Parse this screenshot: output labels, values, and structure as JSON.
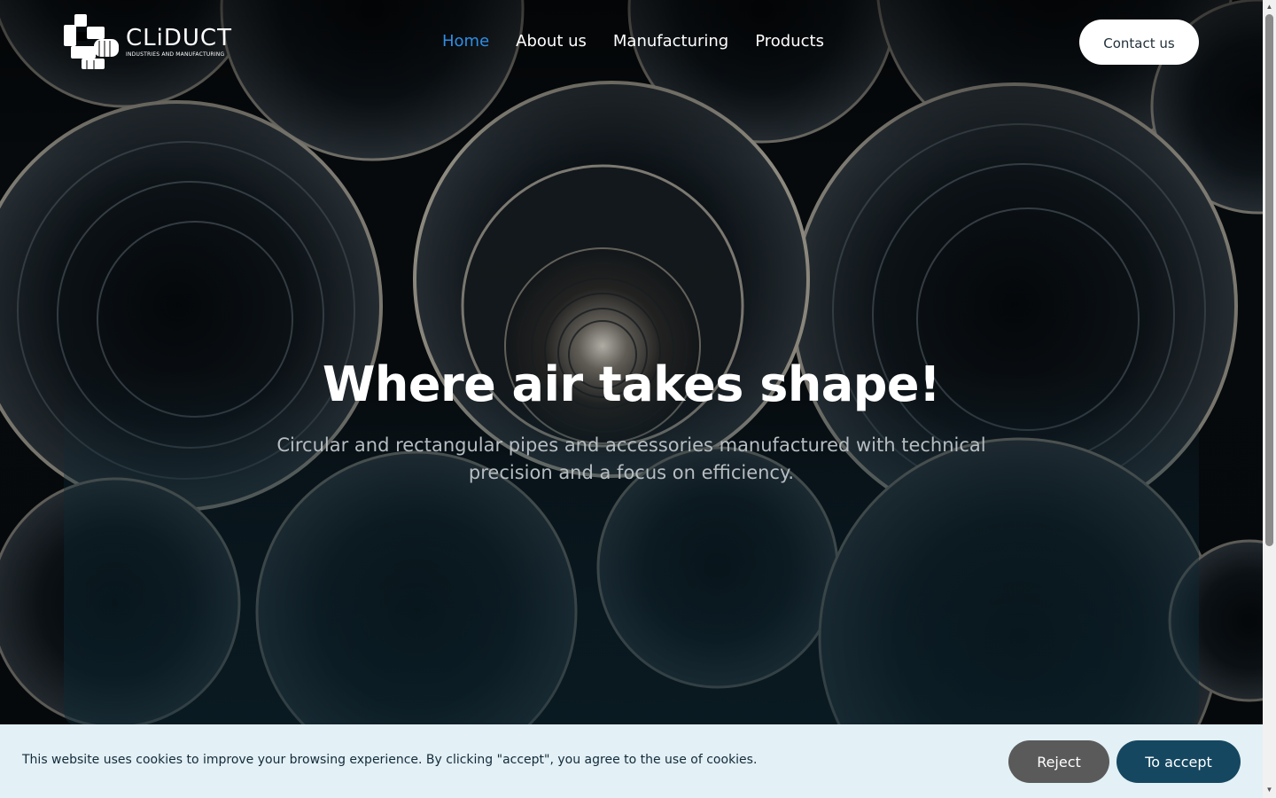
{
  "brand": {
    "name": "CLiDUCT",
    "tagline": "INDUSTRIES AND MANUFACTURING",
    "logo_icon": "duct-logo-icon"
  },
  "nav": {
    "items": [
      {
        "label": "Home",
        "active": true
      },
      {
        "label": "About us",
        "active": false
      },
      {
        "label": "Manufacturing",
        "active": false
      },
      {
        "label": "Products",
        "active": false
      }
    ],
    "contact_label": "Contact us"
  },
  "hero": {
    "title": "Where air takes shape!",
    "subtitle": "Circular and rectangular pipes and accessories manufactured with technical precision and a focus on efficiency."
  },
  "cookie": {
    "message": "This website uses cookies to improve your browsing experience. By clicking \"accept\", you agree to the use of cookies.",
    "reject_label": "Reject",
    "accept_label": "To accept"
  },
  "colors": {
    "active_nav": "#2f8de4",
    "accept_button": "#154761",
    "reject_button": "#5a5a5a",
    "cookie_bar": "#e3f0f5"
  }
}
